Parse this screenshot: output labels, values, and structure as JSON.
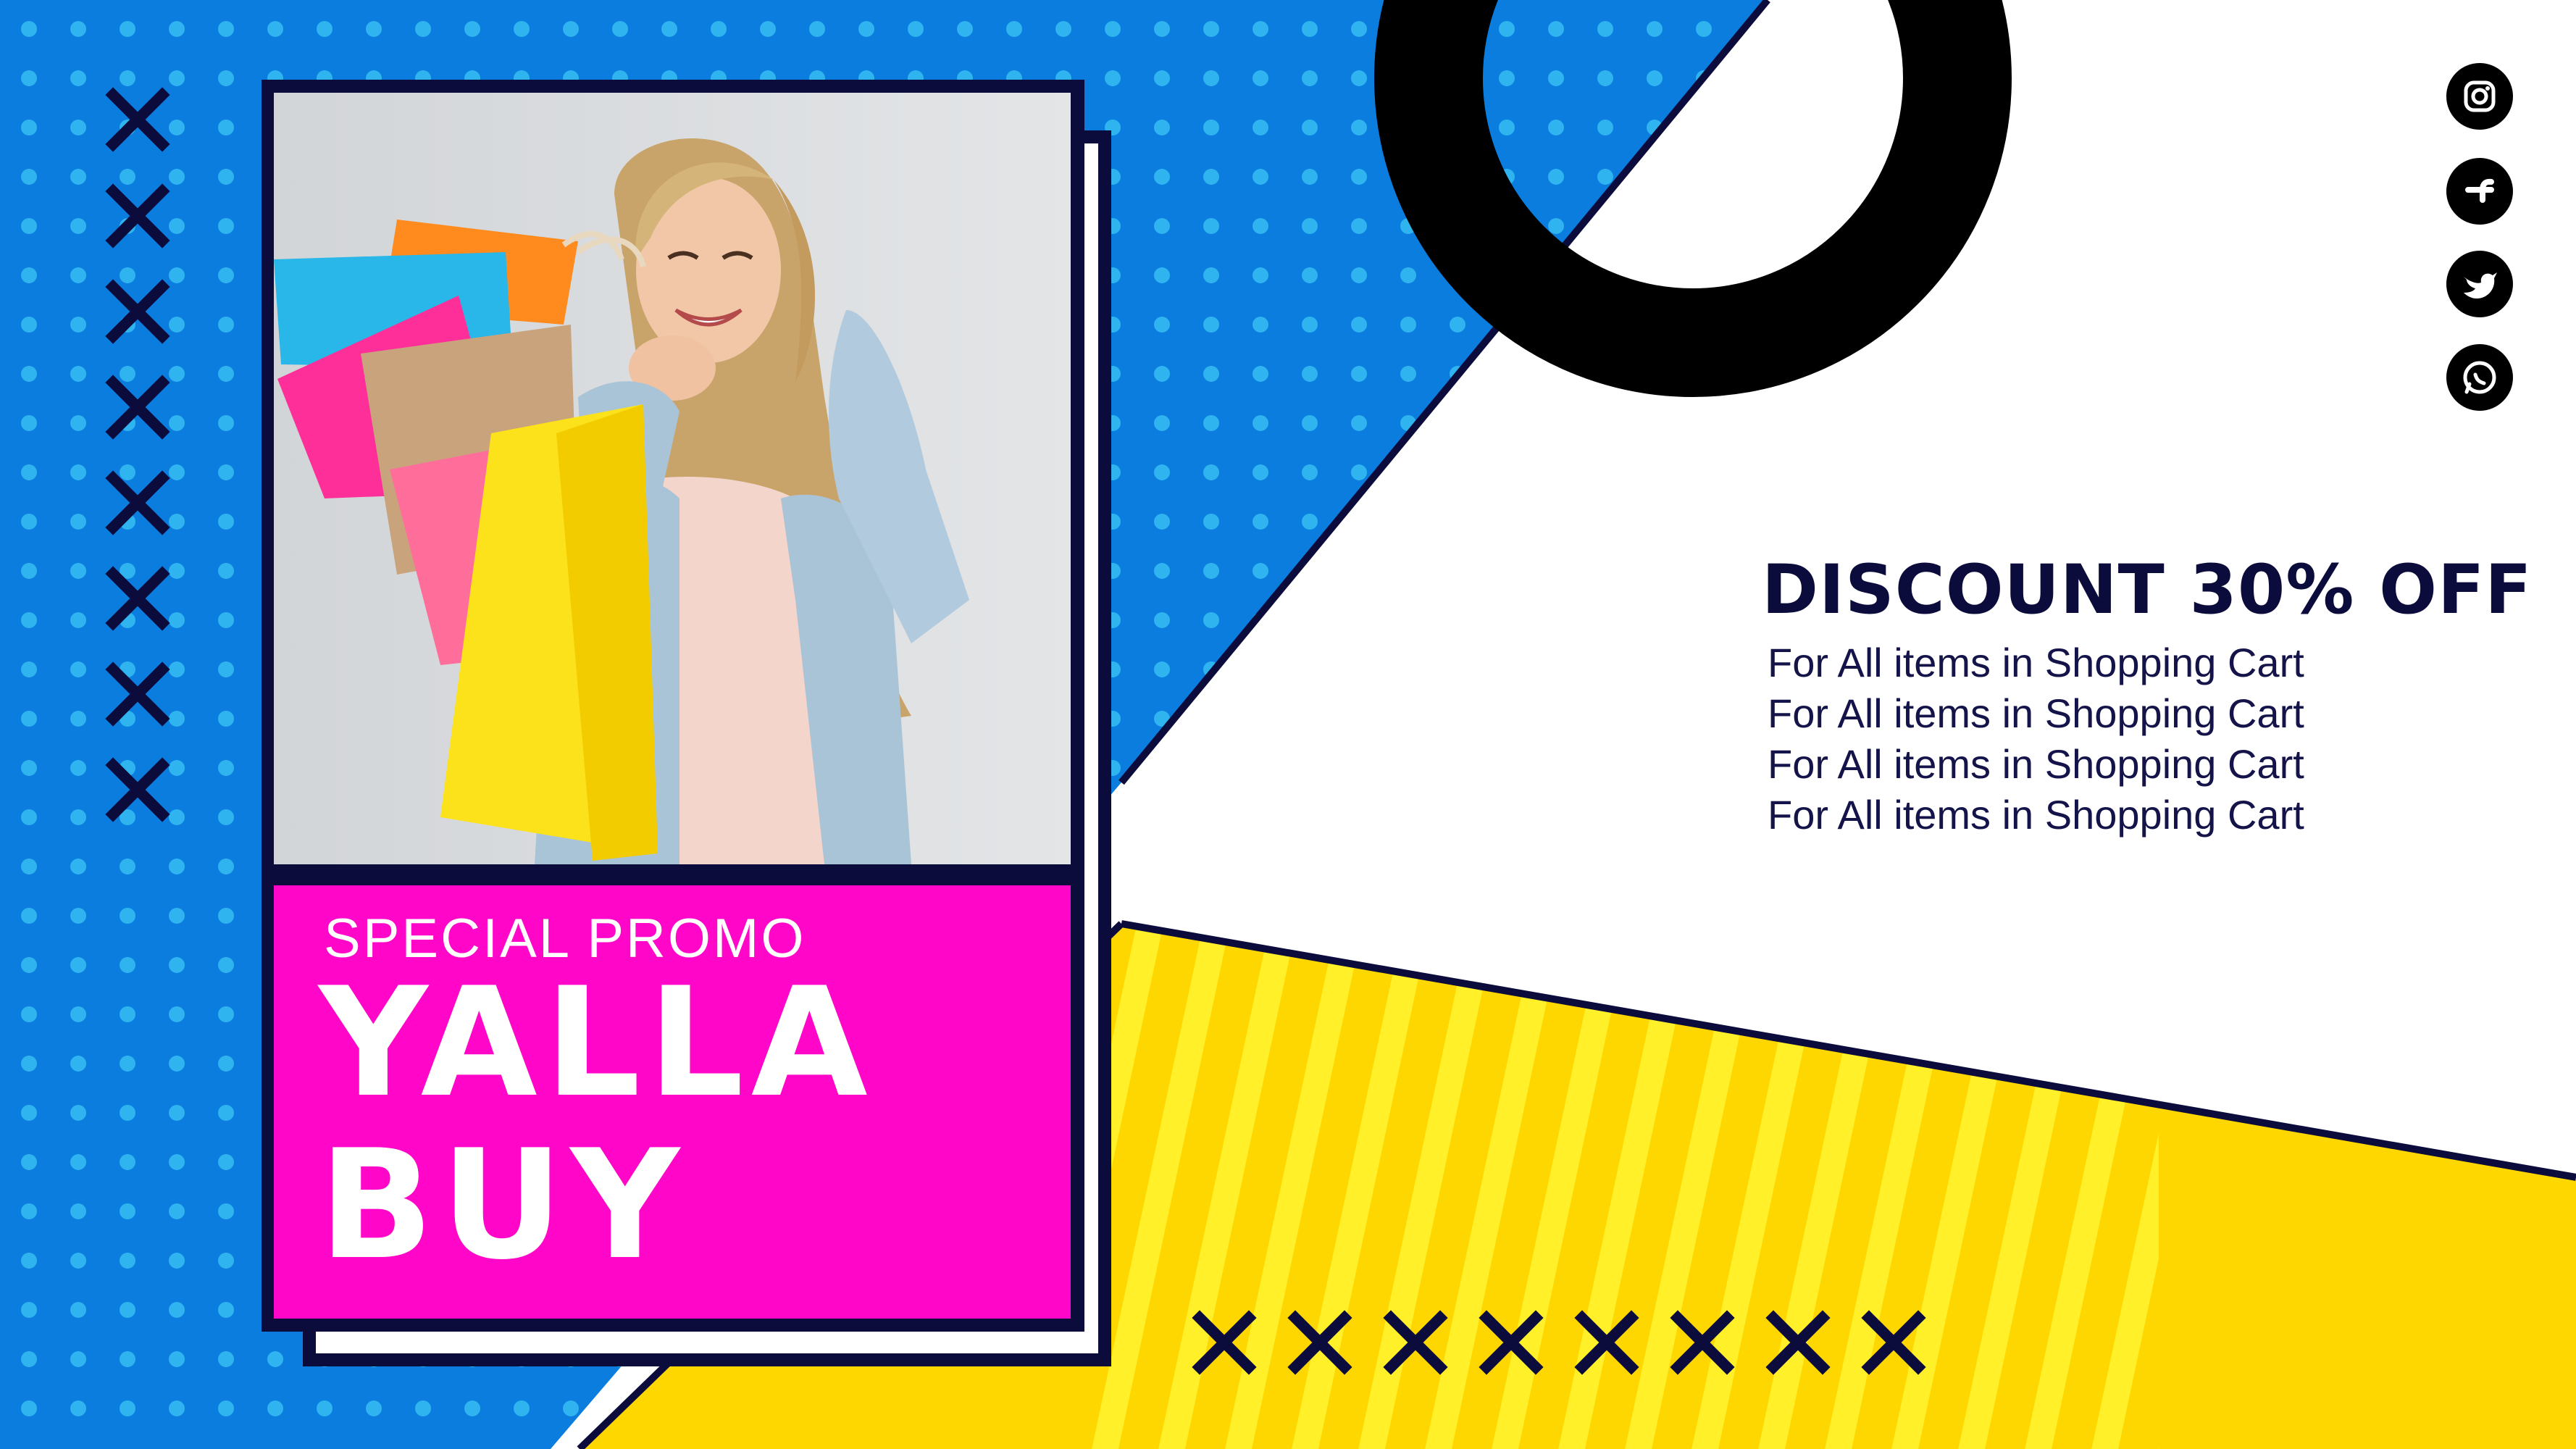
{
  "colors": {
    "blue": "#0a7ddf",
    "dot": "#2fb4ef",
    "navy": "#0b0c3b",
    "magenta": "#ff06c8",
    "yellow": "#ffd700",
    "yellow_stripe": "#fff02a",
    "white": "#ffffff",
    "black": "#000000"
  },
  "promo": {
    "subtitle": "SPECIAL PROMO",
    "title_line1": "YALLA",
    "title_line2": "BUY"
  },
  "discount": {
    "headline": "DISCOUNT 30% OFF",
    "lines": [
      "For All items in Shopping Cart",
      "For All items in Shopping Cart",
      "For All items in Shopping Cart",
      "For All items in Shopping Cart"
    ]
  },
  "social": [
    {
      "icon": "instagram-icon"
    },
    {
      "icon": "facebook-icon"
    },
    {
      "icon": "twitter-icon"
    },
    {
      "icon": "whatsapp-icon"
    }
  ],
  "photo": {
    "subject": "smiling woman holding colorful shopping bags",
    "bag_colors": [
      "#ff8a1e",
      "#29b6e8",
      "#ff2f9a",
      "#ff6e9a",
      "#fbe21a",
      "#c9a37c"
    ]
  },
  "decor": {
    "vertical_x_marks": 8,
    "horizontal_x_marks": 8
  }
}
